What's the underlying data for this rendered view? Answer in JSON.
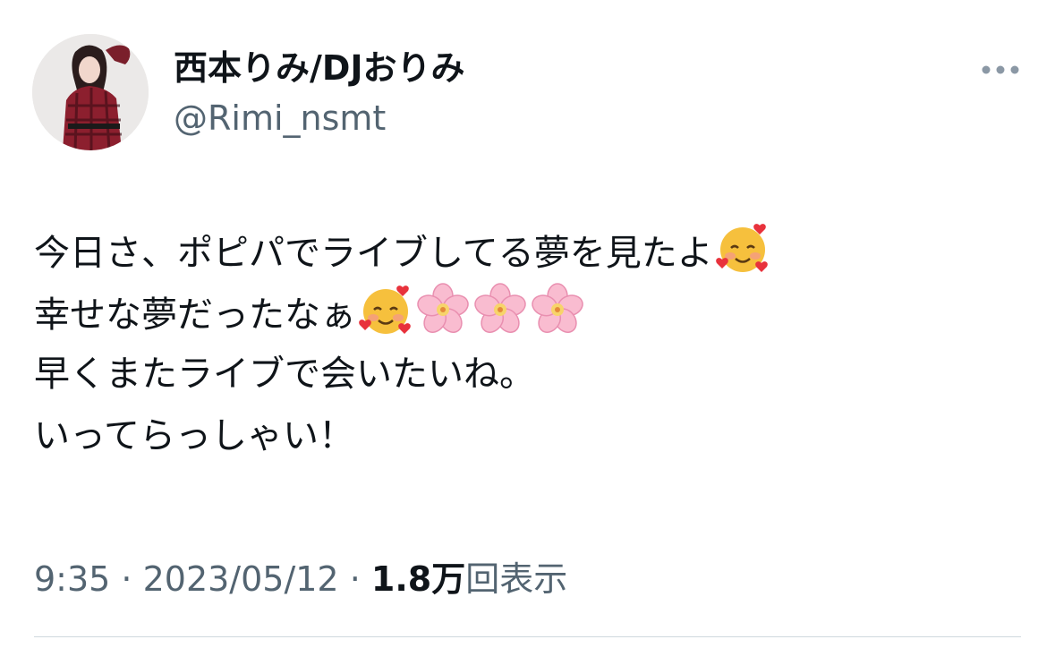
{
  "author": {
    "display_name": "西本りみ/DJおりみ",
    "handle": "@Rimi_nsmt",
    "avatar_icon": "profile-photo"
  },
  "more_icon": "more-horizontal-icon",
  "tweet": {
    "lines": [
      {
        "text": "今日さ、ポピパでライブしてる夢を見たよ",
        "emojis": [
          "smiling-face-with-hearts"
        ]
      },
      {
        "text": "幸せな夢だったなぁ",
        "emojis": [
          "smiling-face-with-hearts",
          "cherry-blossom",
          "cherry-blossom",
          "cherry-blossom"
        ]
      },
      {
        "text": "早くまたライブで会いたいね。",
        "emojis": []
      },
      {
        "text": "いってらっしゃい！",
        "emojis": []
      }
    ]
  },
  "meta": {
    "time": "9:35",
    "separator": " · ",
    "date": "2023/05/12",
    "views_count": "1.8万",
    "views_label": "回表示"
  },
  "colors": {
    "text_primary": "#0f1419",
    "text_secondary": "#536471",
    "divider": "#cfd9de",
    "background": "#ffffff"
  }
}
